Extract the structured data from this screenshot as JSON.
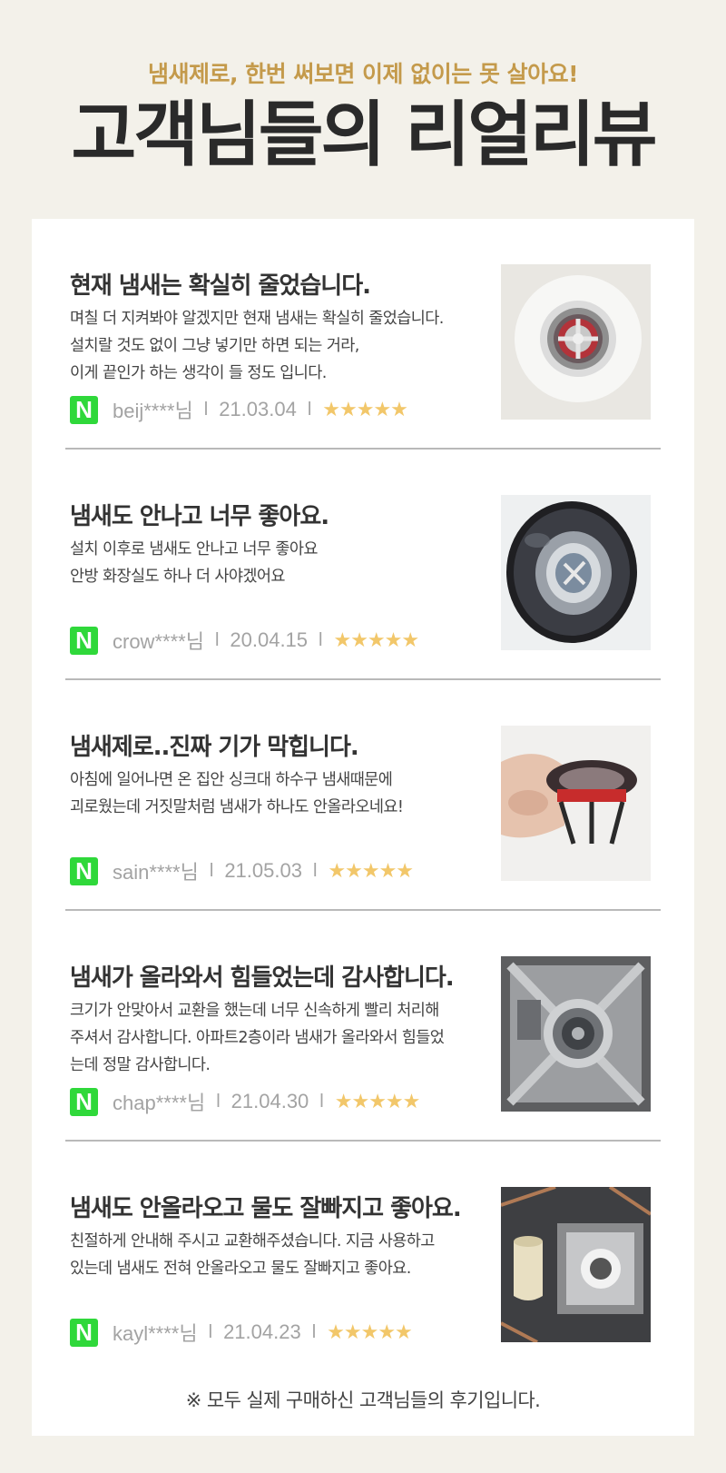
{
  "header": {
    "subtitle": "냄새제로, 한번 써보면 이제 없이는 못 살아요!",
    "title": "고객님들의 리얼리뷰"
  },
  "reviews": [
    {
      "title": "현재 냄새는 확실히 줄었습니다.",
      "body": [
        "며칠 더 지켜봐야 알겠지만 현재 냄새는 확실히 줄었습니다.",
        "설치랄 것도 없이 그냥 넣기만 하면 되는 거라,",
        "이게 끝인가 하는 생각이 들 정도 입니다."
      ],
      "user": "beij****님",
      "date": "21.03.04",
      "stars": "★★★★★"
    },
    {
      "title": "냄새도 안나고 너무 좋아요.",
      "body": [
        "설치 이후로 냄새도 안나고 너무 좋아요",
        "안방 화장실도 하나 더 사야겠어요"
      ],
      "user": "crow****님",
      "date": "20.04.15",
      "stars": "★★★★★"
    },
    {
      "title": "냄새제로..진짜 기가 막힙니다.",
      "body": [
        "아침에 일어나면 온 집안 싱크대 하수구 냄새때문에",
        "괴로웠는데 거짓말처럼 냄새가 하나도 안올라오네요!"
      ],
      "user": "sain****님",
      "date": "21.05.03",
      "stars": "★★★★★"
    },
    {
      "title": "냄새가 올라와서 힘들었는데 감사합니다.",
      "body": [
        "크기가 안맞아서 교환을 했는데 너무 신속하게 빨리 처리해",
        "주셔서 감사합니다. 아파트2층이라 냄새가 올라와서 힘들었",
        "는데 정말 감사합니다."
      ],
      "user": "chap****님",
      "date": "21.04.30",
      "stars": "★★★★★"
    },
    {
      "title": "냄새도 안올라오고 물도 잘빠지고 좋아요.",
      "body": [
        "친절하게 안내해 주시고 교환해주셨습니다. 지금 사용하고",
        "있는데 냄새도 전혀 안올라오고 물도 잘빠지고 좋아요."
      ],
      "user": "kayl****님",
      "date": "21.04.23",
      "stars": "★★★★★"
    }
  ],
  "naver_badge": "N",
  "separator": "l",
  "footer_note": "※ 모두 실제 구매하신 고객님들의 후기입니다."
}
